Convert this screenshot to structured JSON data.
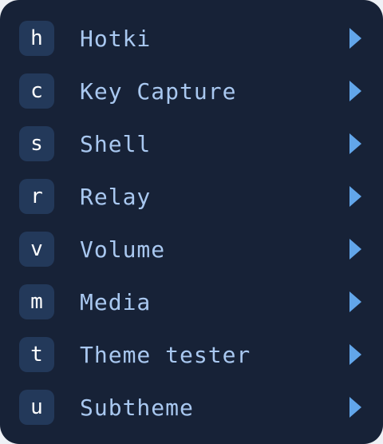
{
  "menu": {
    "items": [
      {
        "key": "h",
        "label": "Hotki"
      },
      {
        "key": "c",
        "label": "Key Capture"
      },
      {
        "key": "s",
        "label": "Shell"
      },
      {
        "key": "r",
        "label": "Relay"
      },
      {
        "key": "v",
        "label": "Volume"
      },
      {
        "key": "m",
        "label": "Media"
      },
      {
        "key": "t",
        "label": "Theme tester"
      },
      {
        "key": "u",
        "label": "Subtheme"
      }
    ]
  },
  "colors": {
    "background": "#172237",
    "badge": "#23395a",
    "label": "#a9c8f0",
    "chevron": "#62a6ea"
  },
  "icons": {
    "submenu": "chevron-right-icon"
  }
}
